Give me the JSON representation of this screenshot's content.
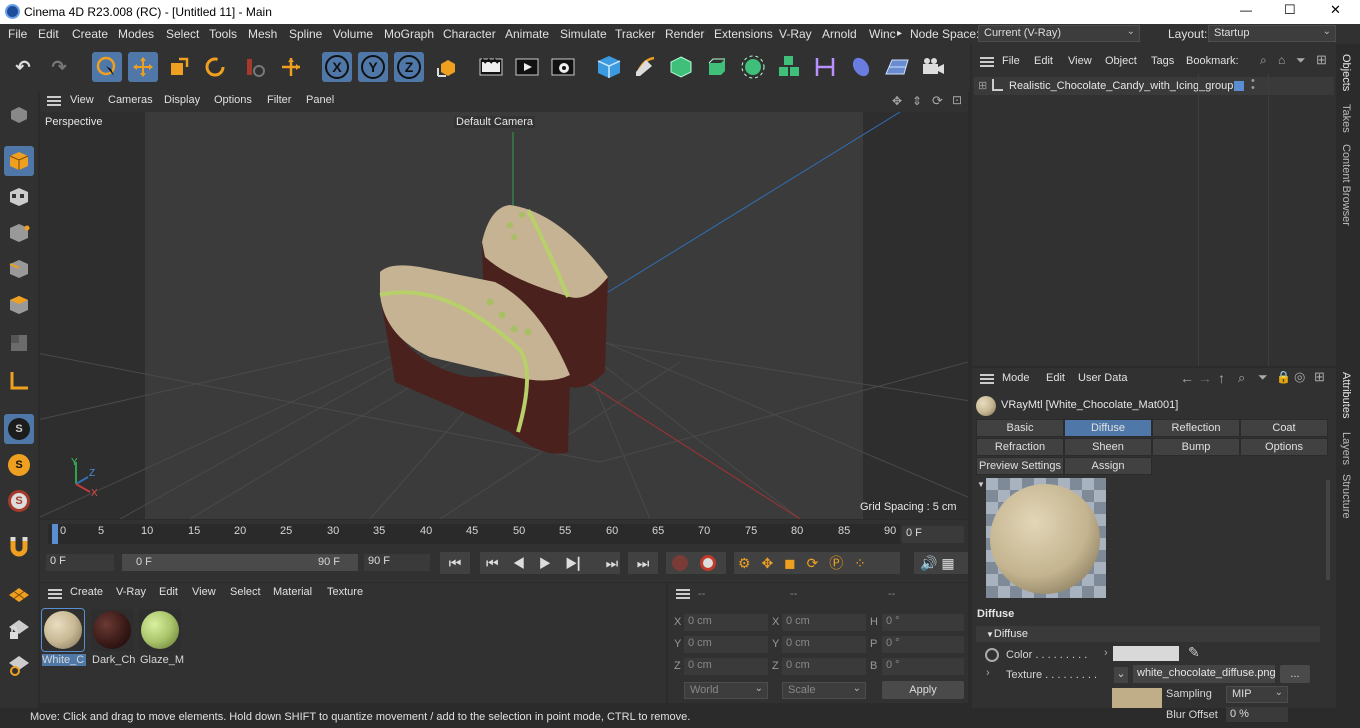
{
  "title": "Cinema 4D R23.008 (RC) - [Untitled 11] - Main",
  "window_controls": {
    "minimize": "—",
    "maximize": "☐",
    "close": "✕"
  },
  "menu": [
    "File",
    "Edit",
    "Create",
    "Modes",
    "Select",
    "Tools",
    "Mesh",
    "Spline",
    "Volume",
    "MoGraph",
    "Character",
    "Animate",
    "Simulate",
    "Tracker",
    "Render",
    "Extensions",
    "V-Ray",
    "Arnold",
    "Winc"
  ],
  "menu_more": "▸",
  "node_space": {
    "label": "Node Space:",
    "value": "Current (V-Ray)"
  },
  "layout": {
    "label": "Layout:",
    "value": "Startup"
  },
  "toolbar": {
    "x": "X",
    "y": "Y",
    "z": "Z"
  },
  "viewport_menu": [
    "View",
    "Cameras",
    "Display",
    "Options",
    "Filter",
    "Panel"
  ],
  "viewport": {
    "mode": "Perspective",
    "camera": "Default Camera",
    "grid": "Grid Spacing : 5 cm",
    "axis_y": "Y",
    "axis_z": "Z",
    "axis_x": "X"
  },
  "timeline": {
    "ticks": [
      "0",
      "5",
      "10",
      "15",
      "20",
      "25",
      "30",
      "35",
      "40",
      "45",
      "50",
      "55",
      "60",
      "65",
      "70",
      "75",
      "80",
      "85",
      "90"
    ],
    "current": "0 F",
    "start": "0 F",
    "range_start": "0 F",
    "range_end": "90 F",
    "end": "90 F"
  },
  "material_menu": [
    "Create",
    "V-Ray",
    "Edit",
    "View",
    "Select",
    "Material",
    "Texture"
  ],
  "materials": [
    {
      "name": "White_C",
      "color": "#c8b894"
    },
    {
      "name": "Dark_Ch",
      "color": "#3a1a18"
    },
    {
      "name": "Glaze_M",
      "color": "#a9c36a"
    }
  ],
  "coords": {
    "head": [
      "--",
      "--",
      "--"
    ],
    "rows": [
      {
        "a": "X",
        "av": "0 cm",
        "b": "X",
        "bv": "0 cm",
        "c": "H",
        "cv": "0 °"
      },
      {
        "a": "Y",
        "av": "0 cm",
        "b": "Y",
        "bv": "0 cm",
        "c": "P",
        "cv": "0 °"
      },
      {
        "a": "Z",
        "av": "0 cm",
        "b": "Z",
        "bv": "0 cm",
        "c": "B",
        "cv": "0 °"
      }
    ],
    "world": "World",
    "scale": "Scale",
    "apply": "Apply"
  },
  "status": "Move: Click and drag to move elements. Hold down SHIFT to quantize movement / add to the selection in point mode, CTRL to remove.",
  "objects_menu": [
    "File",
    "Edit",
    "View",
    "Object",
    "Tags",
    "Bookmark:"
  ],
  "object_item": "Realistic_Chocolate_Candy_with_Icing_group",
  "attr_menu": [
    "Mode",
    "Edit",
    "User Data"
  ],
  "attr_title": "VRayMtl [White_Chocolate_Mat001]",
  "attr_tabs_row1": [
    "Basic",
    "Diffuse",
    "Reflection",
    "Coat"
  ],
  "attr_tabs_row2": [
    "Refraction",
    "Sheen",
    "Bump",
    "Options"
  ],
  "attr_tabs_row3": [
    "Preview Settings",
    "Assign"
  ],
  "diffuse": {
    "section": "Diffuse",
    "group": "Diffuse",
    "color_label": "Color . . . . . . . . .",
    "texture_label": "Texture . . . . . . . . .",
    "texture_file": "white_chocolate_diffuse.png",
    "texture_btn": "...",
    "sampling_label": "Sampling",
    "sampling_value": "MIP",
    "blur_label": "Blur Offset",
    "blur_value": "0 %"
  },
  "right_tabs": [
    "Objects",
    "Takes",
    "Content Browser",
    "Attributes",
    "Layers",
    "Structure"
  ]
}
